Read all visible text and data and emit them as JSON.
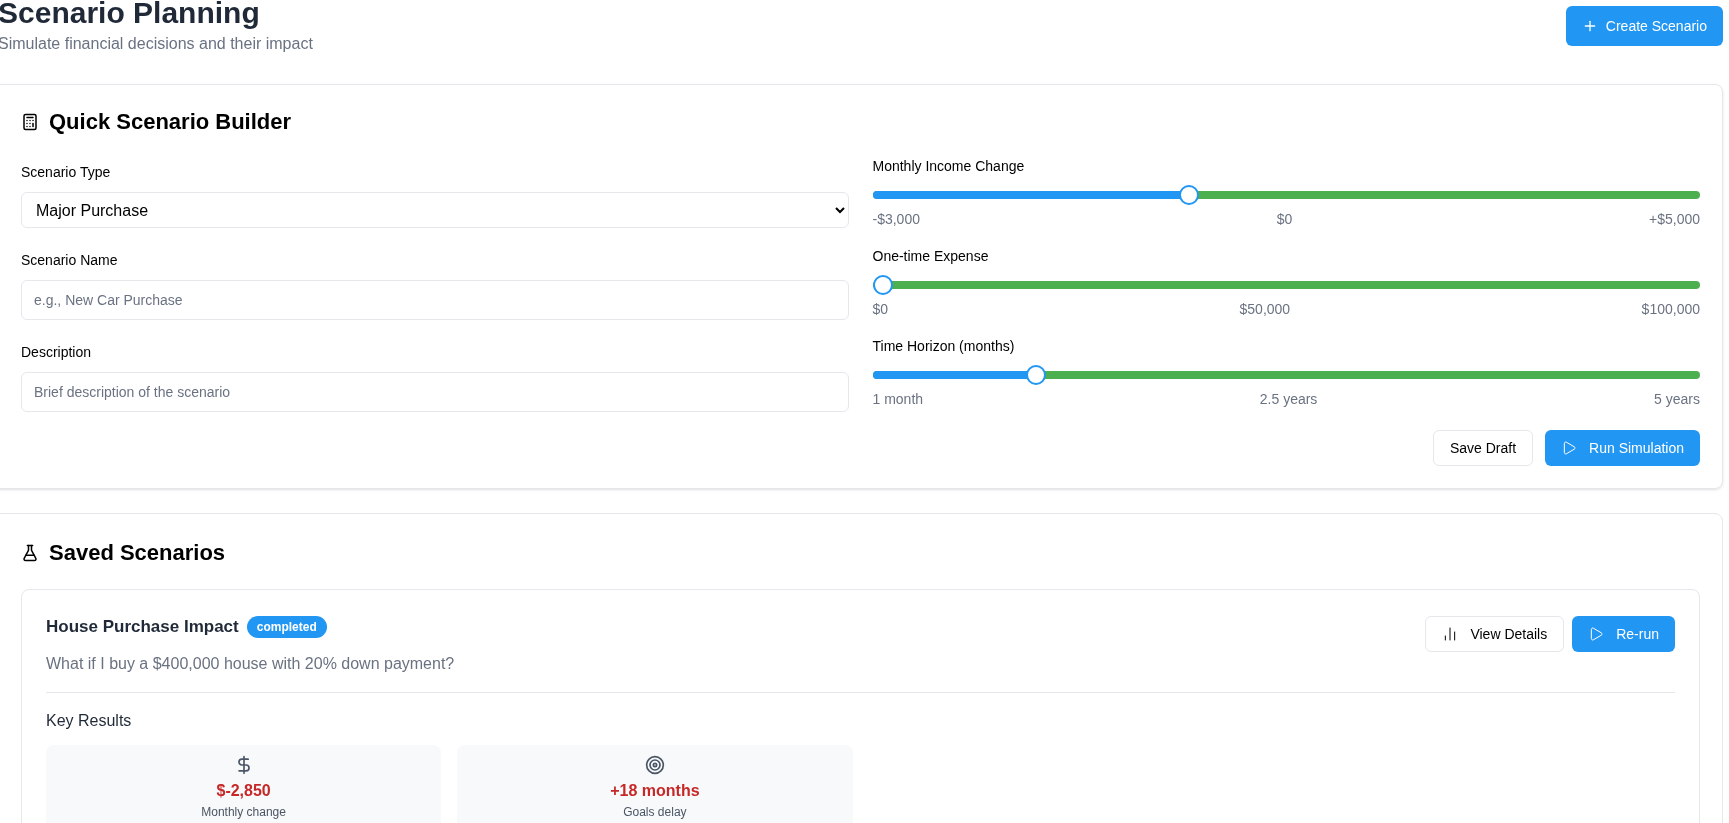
{
  "header": {
    "title": "Scenario Planning",
    "subtitle": "Simulate financial decisions and their impact",
    "create_button": "Create Scenario"
  },
  "builder": {
    "title": "Quick Scenario Builder",
    "fields": [
      {
        "kind": "select",
        "label": "Scenario Type",
        "value": "Major Purchase"
      },
      {
        "kind": "text",
        "label": "Scenario Name",
        "placeholder": "e.g., New Car Purchase"
      },
      {
        "kind": "text",
        "label": "Description",
        "placeholder": "Brief description of the scenario"
      }
    ],
    "sliders": [
      {
        "label": "Monthly Income Change",
        "level": 0.38,
        "ticks": [
          "-$3,000",
          "$0",
          "+$5,000"
        ]
      },
      {
        "label": "One-time Expense",
        "level": 0,
        "ticks": [
          "$0",
          "$50,000",
          "$100,000"
        ]
      },
      {
        "label": "Time Horizon (months)",
        "level": 0.19,
        "ticks": [
          "1 month",
          "2.5 years",
          "5 years"
        ]
      }
    ],
    "buttons": [
      {
        "kind": "secondary",
        "label": "Save Draft"
      },
      {
        "kind": "primary",
        "label": "Run Simulation"
      }
    ]
  },
  "saved": {
    "title": "Saved Scenarios",
    "scenarios": [
      {
        "name": "House Purchase Impact",
        "status": "completed",
        "description": "What if I buy a $400,000 house with 20% down payment?",
        "buttons": [
          {
            "kind": "secondary",
            "label": "View Details"
          },
          {
            "kind": "primary",
            "label": "Re-run"
          }
        ],
        "results_title": "Key Results",
        "results": [
          {
            "kind": "money",
            "value": "$-2,850",
            "label": "Monthly change"
          },
          {
            "kind": "target",
            "value": "+18 months",
            "label": "Goals delay"
          }
        ]
      }
    ]
  }
}
